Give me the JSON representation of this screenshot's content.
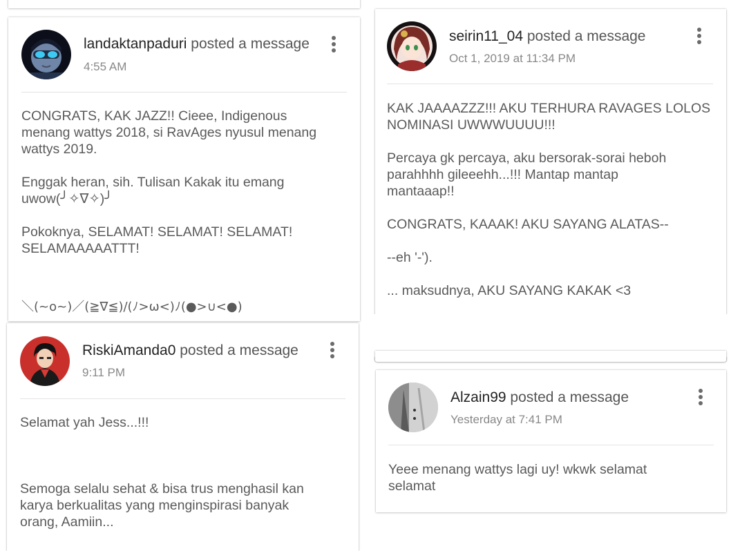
{
  "posted_suffix": "posted a message",
  "cards": [
    {
      "username": "landaktanpaduri",
      "time": "4:55 AM",
      "paragraphs": [
        "CONGRATS, KAK JAZZ!! Cieee, Indigenous\nmenang wattys 2018, si RavAges nyusul menang\nwattys 2019.",
        "Enggak heran, sih. Tulisan Kakak itu emang\nuwow(╯✧∇✧)╯",
        "Pokoknya, SELAMAT! SELAMAT! SELAMAT!\nSELAMAAAAATTT!",
        "",
        "＼(~o~)／(≧∇≦)/(ﾉ>ω<)ﾉ(●>∪<●)"
      ]
    },
    {
      "username": "seirin11_04",
      "time": "Oct 1, 2019 at 11:34 PM",
      "paragraphs": [
        "KAK JAAAAZZZ!!! AKU TERHURA RAVAGES LOLOS\nNOMINASI UWWWUUUU!!!",
        "Percaya gk percaya, aku bersorak-sorai heboh\nparahhhh gileeehh...!!! Mantap mantap\nmantaaap!!",
        "CONGRATS, KAAAK! AKU SAYANG ALATAS--",
        "--eh '-').",
        "... maksudnya, AKU SAYANG KAKAK <3"
      ]
    },
    {
      "username": "RiskiAmanda0",
      "time": "9:11 PM",
      "paragraphs": [
        "Selamat yah Jess...!!!",
        "",
        "",
        "Semoga selalu sehat & bisa trus menghasil kan\nkarya berkualitas yang menginspirasi banyak\norang, Aamiin..."
      ]
    },
    {
      "username": "Alzain99",
      "time": "Yesterday at 7:41 PM",
      "paragraphs": [
        "Yeee menang wattys lagi uy! wkwk selamat\nselamat"
      ]
    }
  ]
}
